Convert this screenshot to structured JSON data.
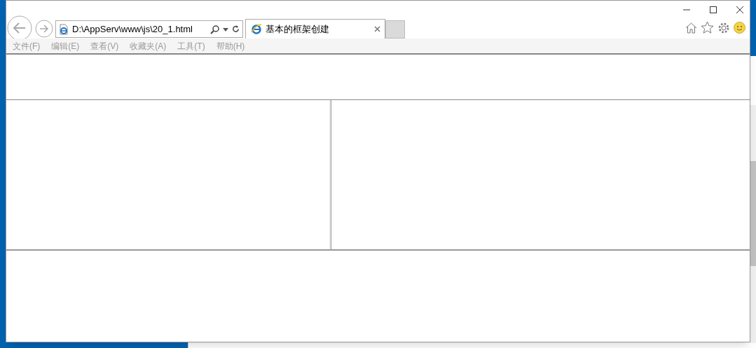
{
  "address_bar": {
    "value": "D:\\AppServ\\www\\js\\20_1.html"
  },
  "tabs": [
    {
      "title": "基本的框架创建",
      "selected": true
    }
  ],
  "menu_bar": [
    "文件(F)",
    "编辑(E)",
    "查看(V)",
    "收藏夹(A)",
    "工具(T)",
    "帮助(H)"
  ]
}
